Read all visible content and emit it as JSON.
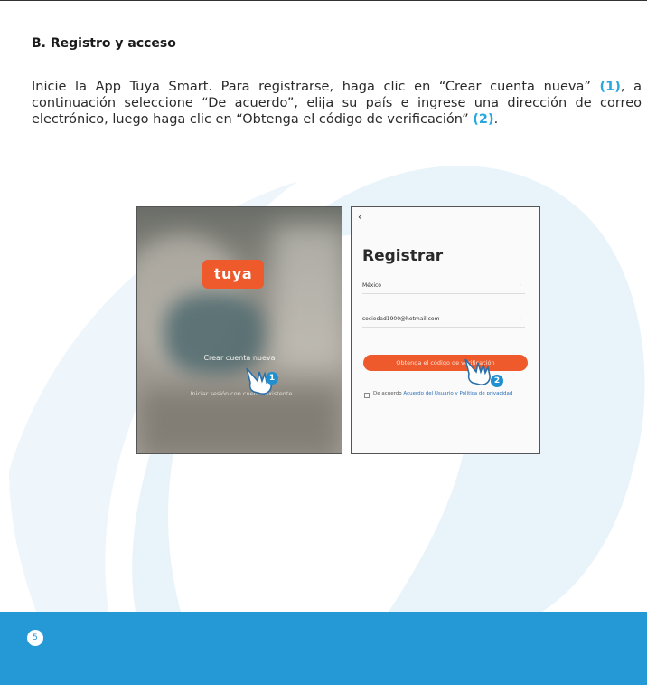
{
  "section": {
    "heading": "B. Registro y acceso",
    "intro_before_1": "Inicie la App Tuya Smart. Para registrarse, haga clic en “Crear cuenta nueva” ",
    "ref_1": "(1)",
    "intro_between": ", a continuación seleccione “De acuerdo”, elija su país e ingrese una dirección de correo electrónico, luego haga clic en “Obtenga el código de verificación” ",
    "ref_2": "(2)",
    "intro_after_2": "."
  },
  "screen1": {
    "logo_text": "tuya",
    "create_account_label": "Crear cuenta nueva",
    "login_label": "Iniciar sesión con cuenta existente",
    "step_badge": "1"
  },
  "screen2": {
    "back_glyph": "‹",
    "title": "Registrar",
    "country_value": "México",
    "email_value": "sociedad1900@hotmail.com",
    "verify_button_label": "Obtenga el código de verificación",
    "agree_prefix": "De acuerdo ",
    "agree_link": "Acuerdo del Usuario y Política de privacidad",
    "step_badge": "2"
  },
  "footer": {
    "page_number": "5"
  },
  "colors": {
    "accent": "#29a8e0",
    "footer": "#2599d6",
    "tuya_orange": "#ee5a2b"
  }
}
